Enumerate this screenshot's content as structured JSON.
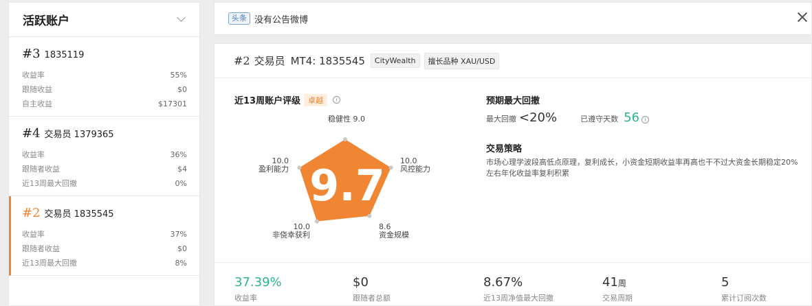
{
  "sidebar": {
    "title": "活跃账户",
    "cards": [
      {
        "rank": "#3",
        "name": "1835119",
        "rows": [
          {
            "label": "收益率",
            "value": "55%"
          },
          {
            "label": "跟随收益",
            "value": "$0"
          },
          {
            "label": "自主收益",
            "value": "$17301"
          }
        ]
      },
      {
        "rank": "#4",
        "name": "交易员 1379365",
        "rows": [
          {
            "label": "收益率",
            "value": "36%"
          },
          {
            "label": "跟随者收益",
            "value": "$4"
          },
          {
            "label": "近13周最大回撤",
            "value": "0%"
          }
        ]
      },
      {
        "rank": "#2",
        "name": "交易员 1835545",
        "rows": [
          {
            "label": "收益率",
            "value": "37%"
          },
          {
            "label": "跟随者收益",
            "value": "$0"
          },
          {
            "label": "近13周最大回撤",
            "value": "8%"
          }
        ]
      }
    ]
  },
  "notice": {
    "tag": "头条",
    "text": "没有公告微博"
  },
  "trader": {
    "rank": "#2",
    "name": "交易员",
    "mt4": "MT4: 1835545",
    "broker": "CityWealth",
    "specialty": "擅长品种 XAU/USD"
  },
  "rating": {
    "title": "近13周账户评级",
    "badge": "卓越",
    "info_icon": "i",
    "score": "9.7",
    "color": "#f08633",
    "axes": [
      {
        "label": "稳健性",
        "value": 9.0,
        "value_text": "9.0"
      },
      {
        "label": "风控能力",
        "value": 10.0,
        "value_text": "10.0"
      },
      {
        "label": "资金规模",
        "value": 8.6,
        "value_text": "8.6"
      },
      {
        "label": "非侥幸获利",
        "value": 10.0,
        "value_text": "10.0"
      },
      {
        "label": "盈利能力",
        "value": 10.0,
        "value_text": "10.0"
      }
    ]
  },
  "drawdown": {
    "title": "预期最大回撤",
    "label": "最大回撤",
    "value": "<20%",
    "days_label": "已遵守天数",
    "days": "56",
    "info_icon": "i"
  },
  "strategy": {
    "title": "交易策略",
    "text": "市场心理学波段高低点原理，复利成长，小资金短期收益率再高也干不过大资金长期稳定20%左右年化收益率复利积累"
  },
  "stats": [
    {
      "value": "37.39%",
      "unit": "",
      "label": "收益率",
      "green": true
    },
    {
      "value": "$0",
      "unit": "",
      "label": "跟随者总额",
      "green": false
    },
    {
      "value": "8.67%",
      "unit": "",
      "label": "近13周净值最大回撤",
      "green": false
    },
    {
      "value": "41",
      "unit": "周",
      "label": "交易周期",
      "green": false
    },
    {
      "value": "5",
      "unit": "",
      "label": "累计订阅次数",
      "green": false
    }
  ]
}
